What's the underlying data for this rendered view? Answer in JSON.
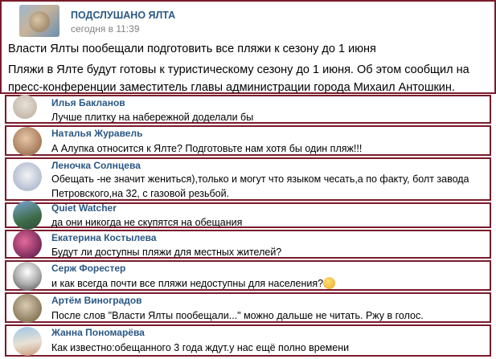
{
  "post": {
    "author": "ПОДСЛУШАНО ЯЛТА",
    "time": "сегодня в 11:39",
    "headline": "Власти Ялты пообещали подготовить все пляжи к сезону до 1 июня",
    "body": "Пляжи в Ялте будут готовы к туристическому сезону до 1 июня. Об этом сообщил на пресс-конференции заместитель главы администрации города Михаил Антошкин."
  },
  "comments": [
    {
      "author": "Илья Бакланов",
      "text": "Лучше плитку на набережной доделали бы"
    },
    {
      "author": "Наталья Журавель",
      "text": "А Алупка относится к Ялте? Подготовьте нам хотя бы один пляж!!!"
    },
    {
      "author": "Леночка Солнцева",
      "text": "Обещать -не значит жениться),только и могут что языком чесать,а по факту, болт завода Петровского,на 32, с газовой резьбой."
    },
    {
      "author": "Quiet Watcher",
      "text": "да они никогда не скупятся на обещания"
    },
    {
      "author": "Екатерина Костылева",
      "text": "Будут ли доступны пляжи для местных жителей?"
    },
    {
      "author": "Серж Форестер",
      "text": "и как всегда почти все пляжи недоступны для населения?"
    },
    {
      "author": "Артём Виноградов",
      "text": "После слов \"Власти Ялты пообещали...\" можно дальше не читать. Ржу в голос."
    },
    {
      "author": "Жанна Пономарёва",
      "text": "Как известно:обещанного 3 года ждут.у нас ещё полно времени"
    }
  ],
  "icons": {
    "comment_6_emoji": "rofl-emoji-icon"
  }
}
